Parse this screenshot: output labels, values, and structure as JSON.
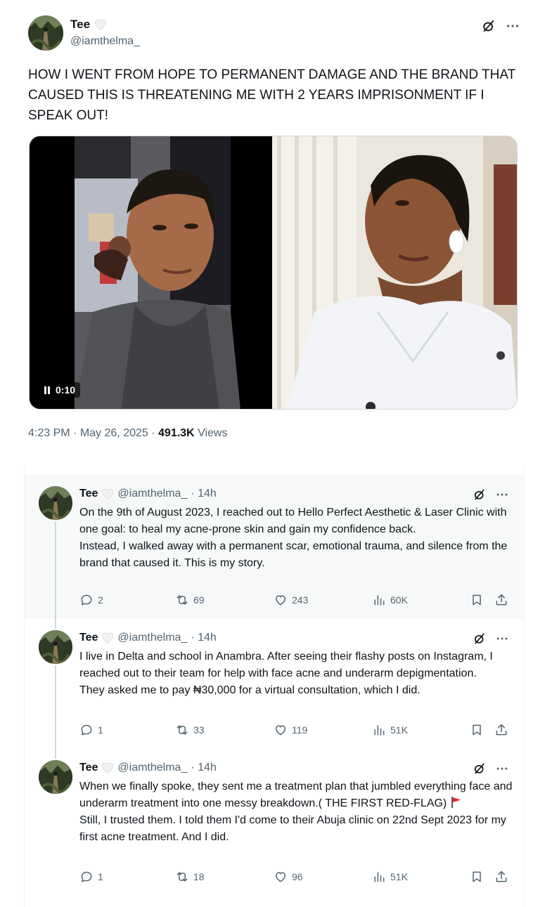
{
  "main_tweet": {
    "author_name": "Tee",
    "author_handle": "@iamthelma_",
    "text": "HOW I WENT FROM HOPE TO PERMANENT DAMAGE AND THE BRAND THAT CAUSED THIS IS THREATENING ME WITH 2 YEARS IMPRISONMENT IF I SPEAK OUT!",
    "video_timestamp": "0:10",
    "time": "4:23 PM",
    "separator": "·",
    "date": "May 26, 2025",
    "views_count": "491.3K",
    "views_label": "Views"
  },
  "icons": {
    "grok": "grok-icon",
    "more": "more-icon",
    "reply": "reply-icon",
    "repost": "repost-icon",
    "like": "like-icon",
    "views": "views-icon",
    "bookmark": "bookmark-icon",
    "share": "share-icon",
    "heart_emoji": "white-heart-emoji",
    "red_flag": "red-flag-emoji"
  },
  "colors": {
    "text": "#0f1419",
    "secondary": "#536471",
    "thread_line": "#cfd9de",
    "highlight_bg": "#f7f9f9",
    "flag": "#f4212e"
  },
  "replies": [
    {
      "author_name": "Tee",
      "author_handle": "@iamthelma_",
      "time_ago": "· 14h",
      "lines": [
        "On the 9th of August 2023, I reached out to Hello Perfect Aesthetic & Laser Clinic with one goal: to heal my acne-prone skin and gain my confidence back.",
        "Instead, I walked away with a permanent scar, emotional trauma, and silence from the brand that caused it. This is my story."
      ],
      "replies": "2",
      "reposts": "69",
      "likes": "243",
      "views": "60K"
    },
    {
      "author_name": "Tee",
      "author_handle": "@iamthelma_",
      "time_ago": "· 14h",
      "lines": [
        "I live in Delta and school in Anambra. After seeing their flashy posts on Instagram, I reached out to their team for help with face acne and underarm depigmentation.",
        "They asked me to pay ₦30,000 for a virtual consultation, which I did."
      ],
      "replies": "1",
      "reposts": "33",
      "likes": "119",
      "views": "51K"
    },
    {
      "author_name": "Tee",
      "author_handle": "@iamthelma_",
      "time_ago": "· 14h",
      "lines": [
        "When we finally spoke, they sent me a treatment plan that jumbled everything face and underarm treatment into one messy breakdown.( THE FIRST RED-FLAG)",
        "Still, I trusted them. I told them I'd come to their Abuja clinic on 22nd Sept 2023 for my first acne treatment. And I did."
      ],
      "replies": "1",
      "reposts": "18",
      "likes": "96",
      "views": "51K"
    }
  ]
}
